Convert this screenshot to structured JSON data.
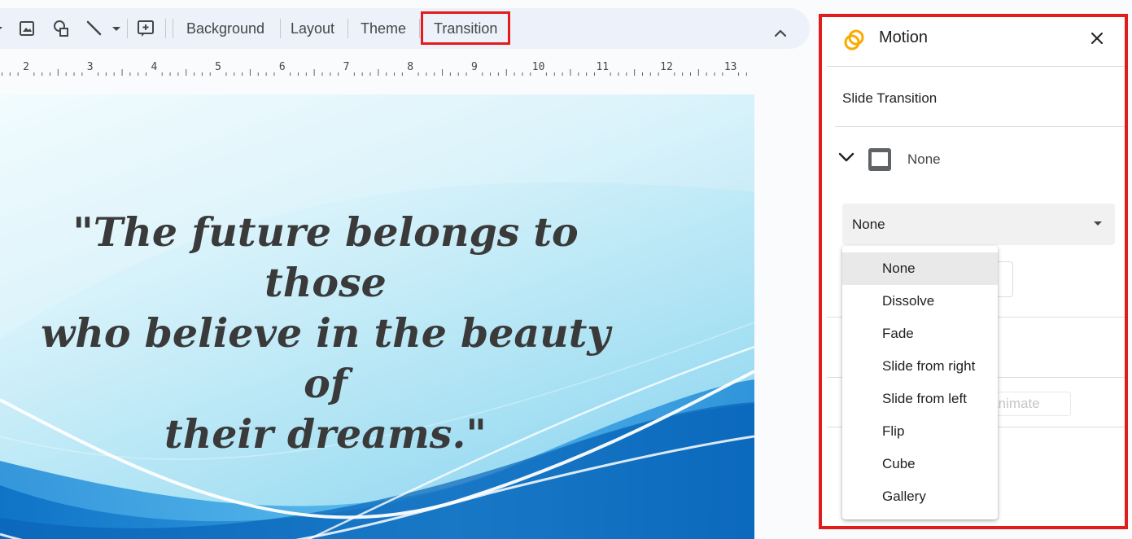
{
  "toolbar": {
    "buttons": {
      "background": "Background",
      "layout": "Layout",
      "theme": "Theme",
      "transition": "Transition"
    },
    "icons": [
      "insert-image-icon",
      "shapes-icon",
      "line-icon",
      "dropdown-arrow-icon",
      "add-comment-icon",
      "collapse-chevron-icon"
    ]
  },
  "ruler": {
    "labels": [
      "2",
      "3",
      "4",
      "5",
      "6",
      "7",
      "8",
      "9",
      "10",
      "11",
      "12",
      "13"
    ]
  },
  "slide": {
    "quote_line1": "\"The future belongs to those",
    "quote_line2": "who believe in the beauty of",
    "quote_line3": "their dreams.\""
  },
  "panel": {
    "title": "Motion",
    "section_label": "Slide Transition",
    "current_transition": "None",
    "select_value": "None",
    "animate_label": "o animate"
  },
  "menu": {
    "items": [
      "None",
      "Dissolve",
      "Fade",
      "Slide from right",
      "Slide from left",
      "Flip",
      "Cube",
      "Gallery"
    ],
    "selected_index": 0
  },
  "colors": {
    "highlight": "#e21b1b",
    "motion_icon": "#f9ab00",
    "toolbar_bg": "#edf2fa"
  }
}
